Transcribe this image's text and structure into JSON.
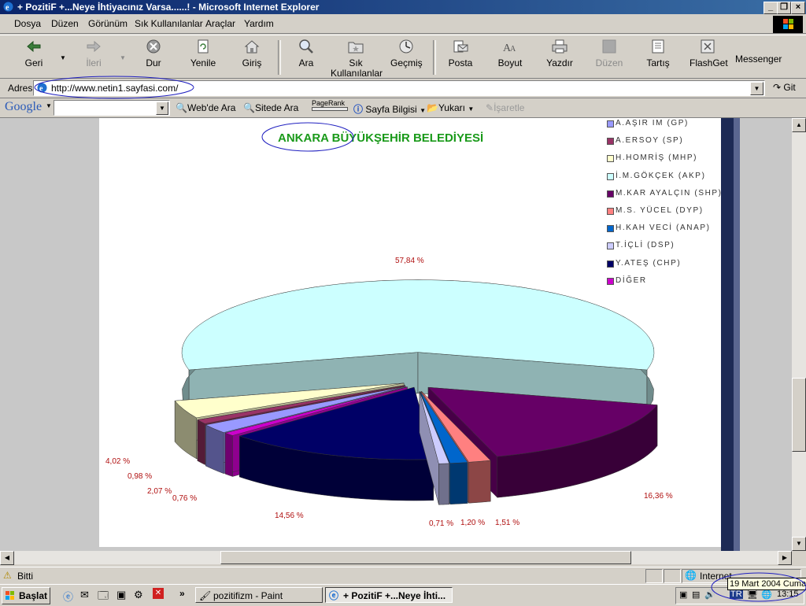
{
  "window": {
    "title": "+ PozitiF +...Neye İhtiyacınız Varsa......! - Microsoft Internet Explorer",
    "minimize": "_",
    "restore": "❐",
    "close": "×"
  },
  "menubar": [
    "Dosya",
    "Düzen",
    "Görünüm",
    "Sık Kullanılanlar",
    "Araçlar",
    "Yardım"
  ],
  "toolbar": {
    "back": "Geri",
    "forward": "İleri",
    "stop": "Dur",
    "refresh": "Yenile",
    "home": "Giriş",
    "search": "Ara",
    "favorites_line1": "Sık",
    "favorites_line2": "Kullanılanlar",
    "history": "Geçmiş",
    "mail": "Posta",
    "size": "Boyut",
    "print": "Yazdır",
    "edit": "Düzen",
    "discuss": "Tartış",
    "flashget": "FlashGet",
    "messenger": "Messenger"
  },
  "address": {
    "label": "Adres",
    "url": "http://www.netin1.sayfasi.com/",
    "go": "Git"
  },
  "googlebar": {
    "logo": "Google",
    "search_web": "Web'de Ara",
    "search_site": "Sitede Ara",
    "pagerank": "PageRank",
    "page_info": "Sayfa Bilgisi",
    "up": "Yukarı",
    "highlight": "İşaretle"
  },
  "colors": {
    "akp": "#ccffff",
    "shp": "#660066",
    "chp": "#000066",
    "mhp": "#ffffcc",
    "diger": "#cc00cc",
    "sp": "#993366",
    "gp": "#9999ff",
    "dyp": "#ff8080",
    "anap": "#0066cc",
    "dsp": "#ccccff",
    "title_green": "#1a9a1a"
  },
  "chart_data": {
    "type": "pie",
    "title": "ANKARA BÜYÜKŞEHİR BELEDİYESİ",
    "legend_position": "top-right",
    "legend": [
      {
        "key": "gp",
        "label": "A.AŞIR IM (GP)"
      },
      {
        "key": "sp",
        "label": "A.ERSOY (SP)"
      },
      {
        "key": "mhp",
        "label": "H.HOMRİŞ (MHP)"
      },
      {
        "key": "akp",
        "label": "İ.M.GÖKÇEK (AKP)"
      },
      {
        "key": "shp",
        "label": "M.KAR AYALÇIN (SHP)"
      },
      {
        "key": "dyp",
        "label": "M.S. YÜCEL (DYP)"
      },
      {
        "key": "anap",
        "label": "H.KAH VECİ (ANAP)"
      },
      {
        "key": "dsp",
        "label": "T.İÇLİ (DSP)"
      },
      {
        "key": "chp",
        "label": "Y.ATEŞ (CHP)"
      },
      {
        "key": "diger",
        "label": "DİĞER"
      }
    ],
    "slices": [
      {
        "key": "akp",
        "value": 57.84,
        "label": "57,84 %"
      },
      {
        "key": "shp",
        "value": 16.36,
        "label": "16,36 %"
      },
      {
        "key": "dyp",
        "value": 1.51,
        "label": "1,51 %"
      },
      {
        "key": "anap",
        "value": 1.2,
        "label": "1,20 %"
      },
      {
        "key": "dsp",
        "value": 0.71,
        "label": "0,71 %"
      },
      {
        "key": "chp",
        "value": 14.56,
        "label": "14,56 %"
      },
      {
        "key": "diger",
        "value": 0.76,
        "label": "0,76 %"
      },
      {
        "key": "gp",
        "value": 2.07,
        "label": "2,07 %"
      },
      {
        "key": "sp",
        "value": 0.98,
        "label": "0,98 %"
      },
      {
        "key": "mhp",
        "value": 4.02,
        "label": "4,02 %"
      }
    ]
  },
  "status": {
    "text": "Bitti",
    "zone": "Internet"
  },
  "taskbar": {
    "start": "Başlat",
    "tasks": [
      "pozitifizm - Paint",
      "+ PozitiF +...Neye İhti..."
    ],
    "clock": "13:15",
    "tooltip": "19 Mart 2004 Cuma",
    "lang": "TR",
    "chevron": "»"
  }
}
